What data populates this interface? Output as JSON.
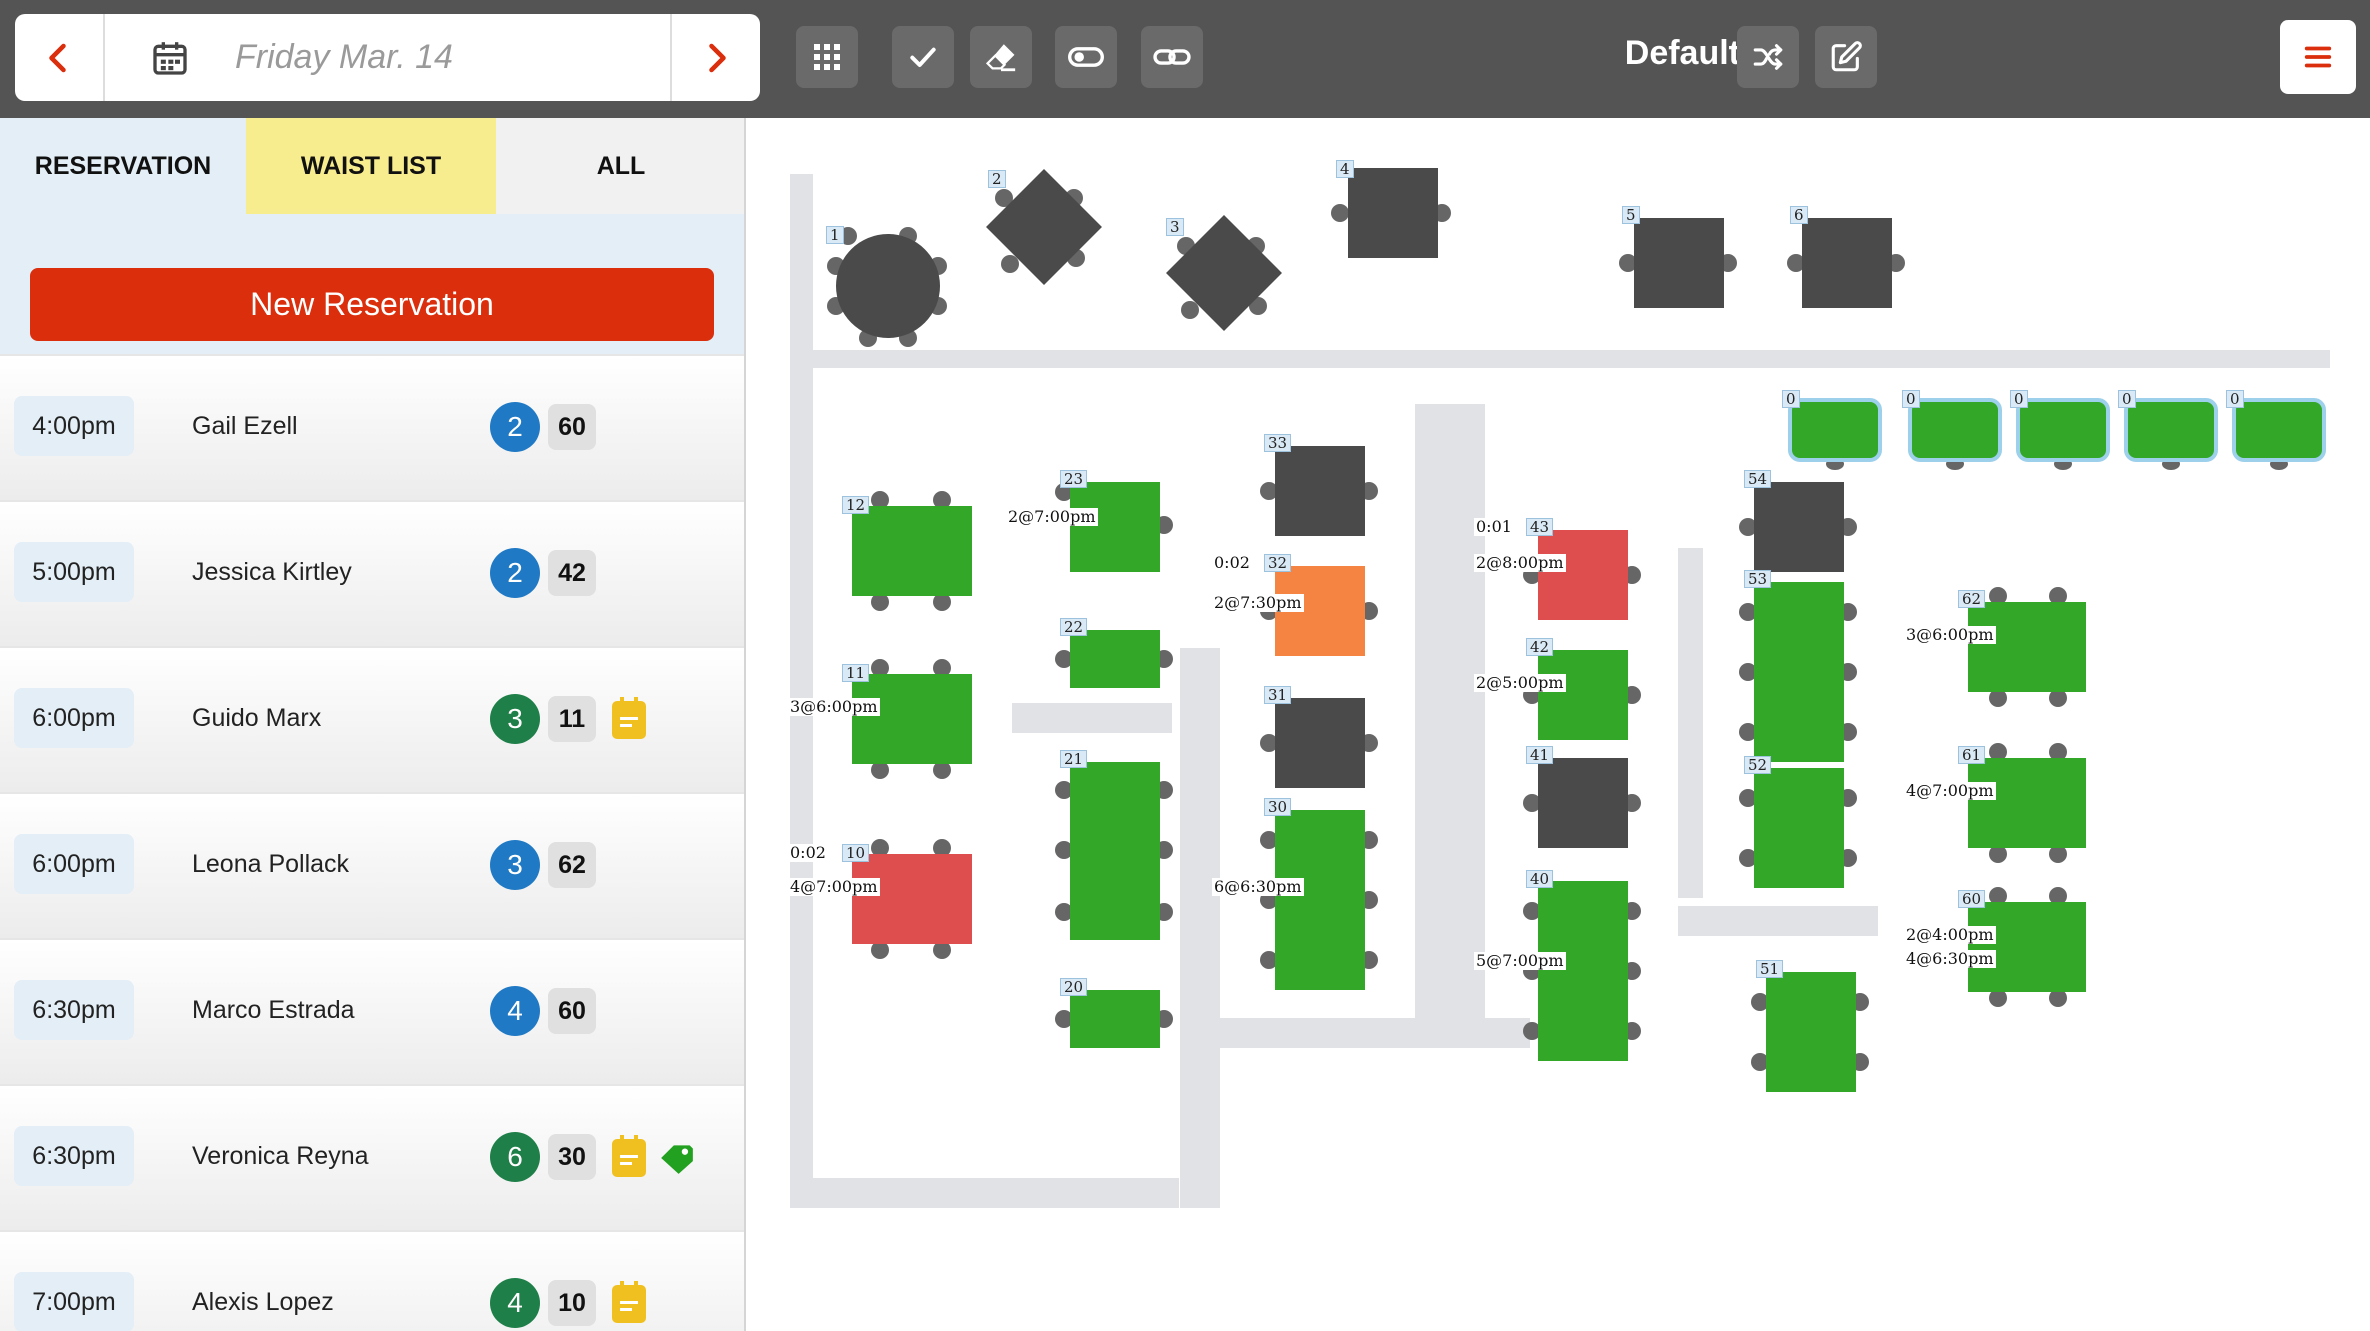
{
  "header": {
    "date_label": "Friday Mar. 14",
    "layout_name": "Default",
    "toolbar_icons": [
      "grid-icon",
      "check-icon",
      "eraser-icon",
      "toggle-icon",
      "link-icon"
    ],
    "colors": {
      "bar": "#545454",
      "accent": "#db2e0d"
    }
  },
  "sidebar": {
    "tabs": [
      "RESERVATION",
      "WAIST LIST",
      "ALL"
    ],
    "new_reservation_label": "New Reservation",
    "reservations": [
      {
        "time": "4:00pm",
        "name": "Gail Ezell",
        "party": "2",
        "party_color": "#1f79c4",
        "table": "60",
        "note": false,
        "tag": false
      },
      {
        "time": "5:00pm",
        "name": "Jessica Kirtley",
        "party": "2",
        "party_color": "#1f79c4",
        "table": "42",
        "note": false,
        "tag": false
      },
      {
        "time": "6:00pm",
        "name": "Guido Marx",
        "party": "3",
        "party_color": "#1e7f48",
        "table": "11",
        "note": true,
        "tag": false
      },
      {
        "time": "6:00pm",
        "name": "Leona Pollack",
        "party": "3",
        "party_color": "#1f79c4",
        "table": "62",
        "note": false,
        "tag": false
      },
      {
        "time": "6:30pm",
        "name": "Marco Estrada",
        "party": "4",
        "party_color": "#1f79c4",
        "table": "60",
        "note": false,
        "tag": false
      },
      {
        "time": "6:30pm",
        "name": "Veronica Reyna",
        "party": "6",
        "party_color": "#1e7f48",
        "table": "30",
        "note": true,
        "tag": true
      },
      {
        "time": "7:00pm",
        "name": "Alexis Lopez",
        "party": "4",
        "party_color": "#1e7f48",
        "table": "10",
        "note": true,
        "tag": false
      }
    ]
  },
  "floor": {
    "status_colors": {
      "seated": "#33a727",
      "idle": "#4a4a4a",
      "warning": "#f58443",
      "late": "#df4e4e"
    },
    "tables": [
      {
        "num": "1",
        "status": "idle",
        "shape": "round"
      },
      {
        "num": "2",
        "status": "idle",
        "shape": "diamond"
      },
      {
        "num": "3",
        "status": "idle",
        "shape": "diamond"
      },
      {
        "num": "4",
        "status": "idle"
      },
      {
        "num": "5",
        "status": "idle"
      },
      {
        "num": "6",
        "status": "idle"
      },
      {
        "num": "0",
        "status": "seated"
      },
      {
        "num": "0",
        "status": "seated"
      },
      {
        "num": "0",
        "status": "seated"
      },
      {
        "num": "0",
        "status": "seated"
      },
      {
        "num": "0",
        "status": "seated"
      },
      {
        "num": "12",
        "status": "seated"
      },
      {
        "num": "11",
        "status": "seated",
        "reservations": [
          "3@6:00pm"
        ]
      },
      {
        "num": "10",
        "status": "late",
        "timer": "0:02",
        "reservations": [
          "4@7:00pm"
        ]
      },
      {
        "num": "23",
        "status": "seated",
        "reservations": [
          "2@7:00pm"
        ]
      },
      {
        "num": "22",
        "status": "seated"
      },
      {
        "num": "21",
        "status": "seated"
      },
      {
        "num": "20",
        "status": "seated"
      },
      {
        "num": "33",
        "status": "idle"
      },
      {
        "num": "32",
        "status": "warning",
        "timer": "0:02",
        "reservations": [
          "2@7:30pm"
        ]
      },
      {
        "num": "31",
        "status": "idle"
      },
      {
        "num": "30",
        "status": "seated",
        "reservations": [
          "6@6:30pm"
        ]
      },
      {
        "num": "43",
        "status": "late",
        "timer": "0:01",
        "reservations": [
          "2@8:00pm"
        ]
      },
      {
        "num": "42",
        "status": "seated",
        "reservations": [
          "2@5:00pm"
        ]
      },
      {
        "num": "41",
        "status": "idle"
      },
      {
        "num": "40",
        "status": "seated",
        "reservations": [
          "5@7:00pm"
        ]
      },
      {
        "num": "54",
        "status": "idle"
      },
      {
        "num": "53",
        "status": "seated"
      },
      {
        "num": "52",
        "status": "seated"
      },
      {
        "num": "51",
        "status": "seated"
      },
      {
        "num": "62",
        "status": "seated",
        "reservations": [
          "3@6:00pm"
        ]
      },
      {
        "num": "61",
        "status": "seated",
        "reservations": [
          "4@7:00pm"
        ]
      },
      {
        "num": "60",
        "status": "seated",
        "reservations": [
          "2@4:00pm",
          "4@6:30pm"
        ]
      }
    ]
  }
}
